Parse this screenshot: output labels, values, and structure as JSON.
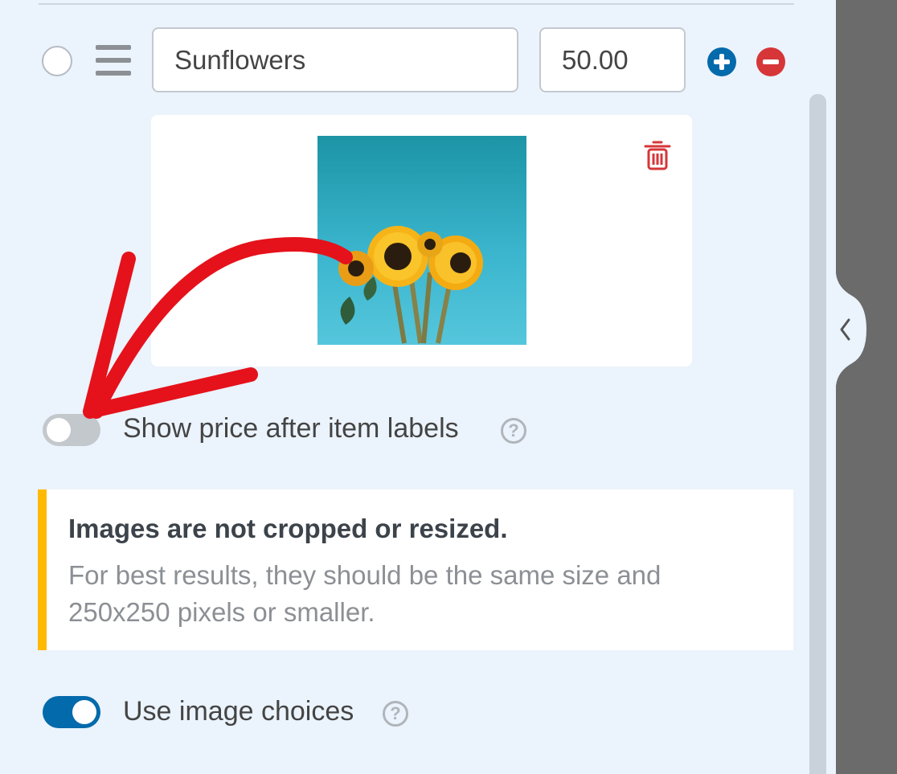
{
  "choice": {
    "label_value": "Sunflowers",
    "price_value": "50.00",
    "add_label": "+",
    "remove_label": "−"
  },
  "image": {
    "alt": "Sunflowers on a blue background"
  },
  "price_toggle": {
    "label": "Show price after item labels",
    "enabled": false,
    "help_glyph": "?"
  },
  "notice": {
    "title": "Images are not cropped or resized.",
    "body": "For best results, they should be the same size and 250x250 pixels or smaller."
  },
  "image_choices_toggle": {
    "label": "Use image choices",
    "enabled": true,
    "help_glyph": "?"
  },
  "colors": {
    "panel_bg": "#ebf3fc",
    "accent_blue": "#036aab",
    "danger_red": "#d63638",
    "notice_border": "#ffb900",
    "annotation_arrow": "#e5121b"
  },
  "icons": {
    "radio": "radio-icon",
    "drag": "drag-handle-icon",
    "add": "plus-circle-icon",
    "remove": "minus-circle-icon",
    "trash": "trash-icon",
    "help": "question-circle-icon",
    "collapse": "chevron-left-icon"
  }
}
